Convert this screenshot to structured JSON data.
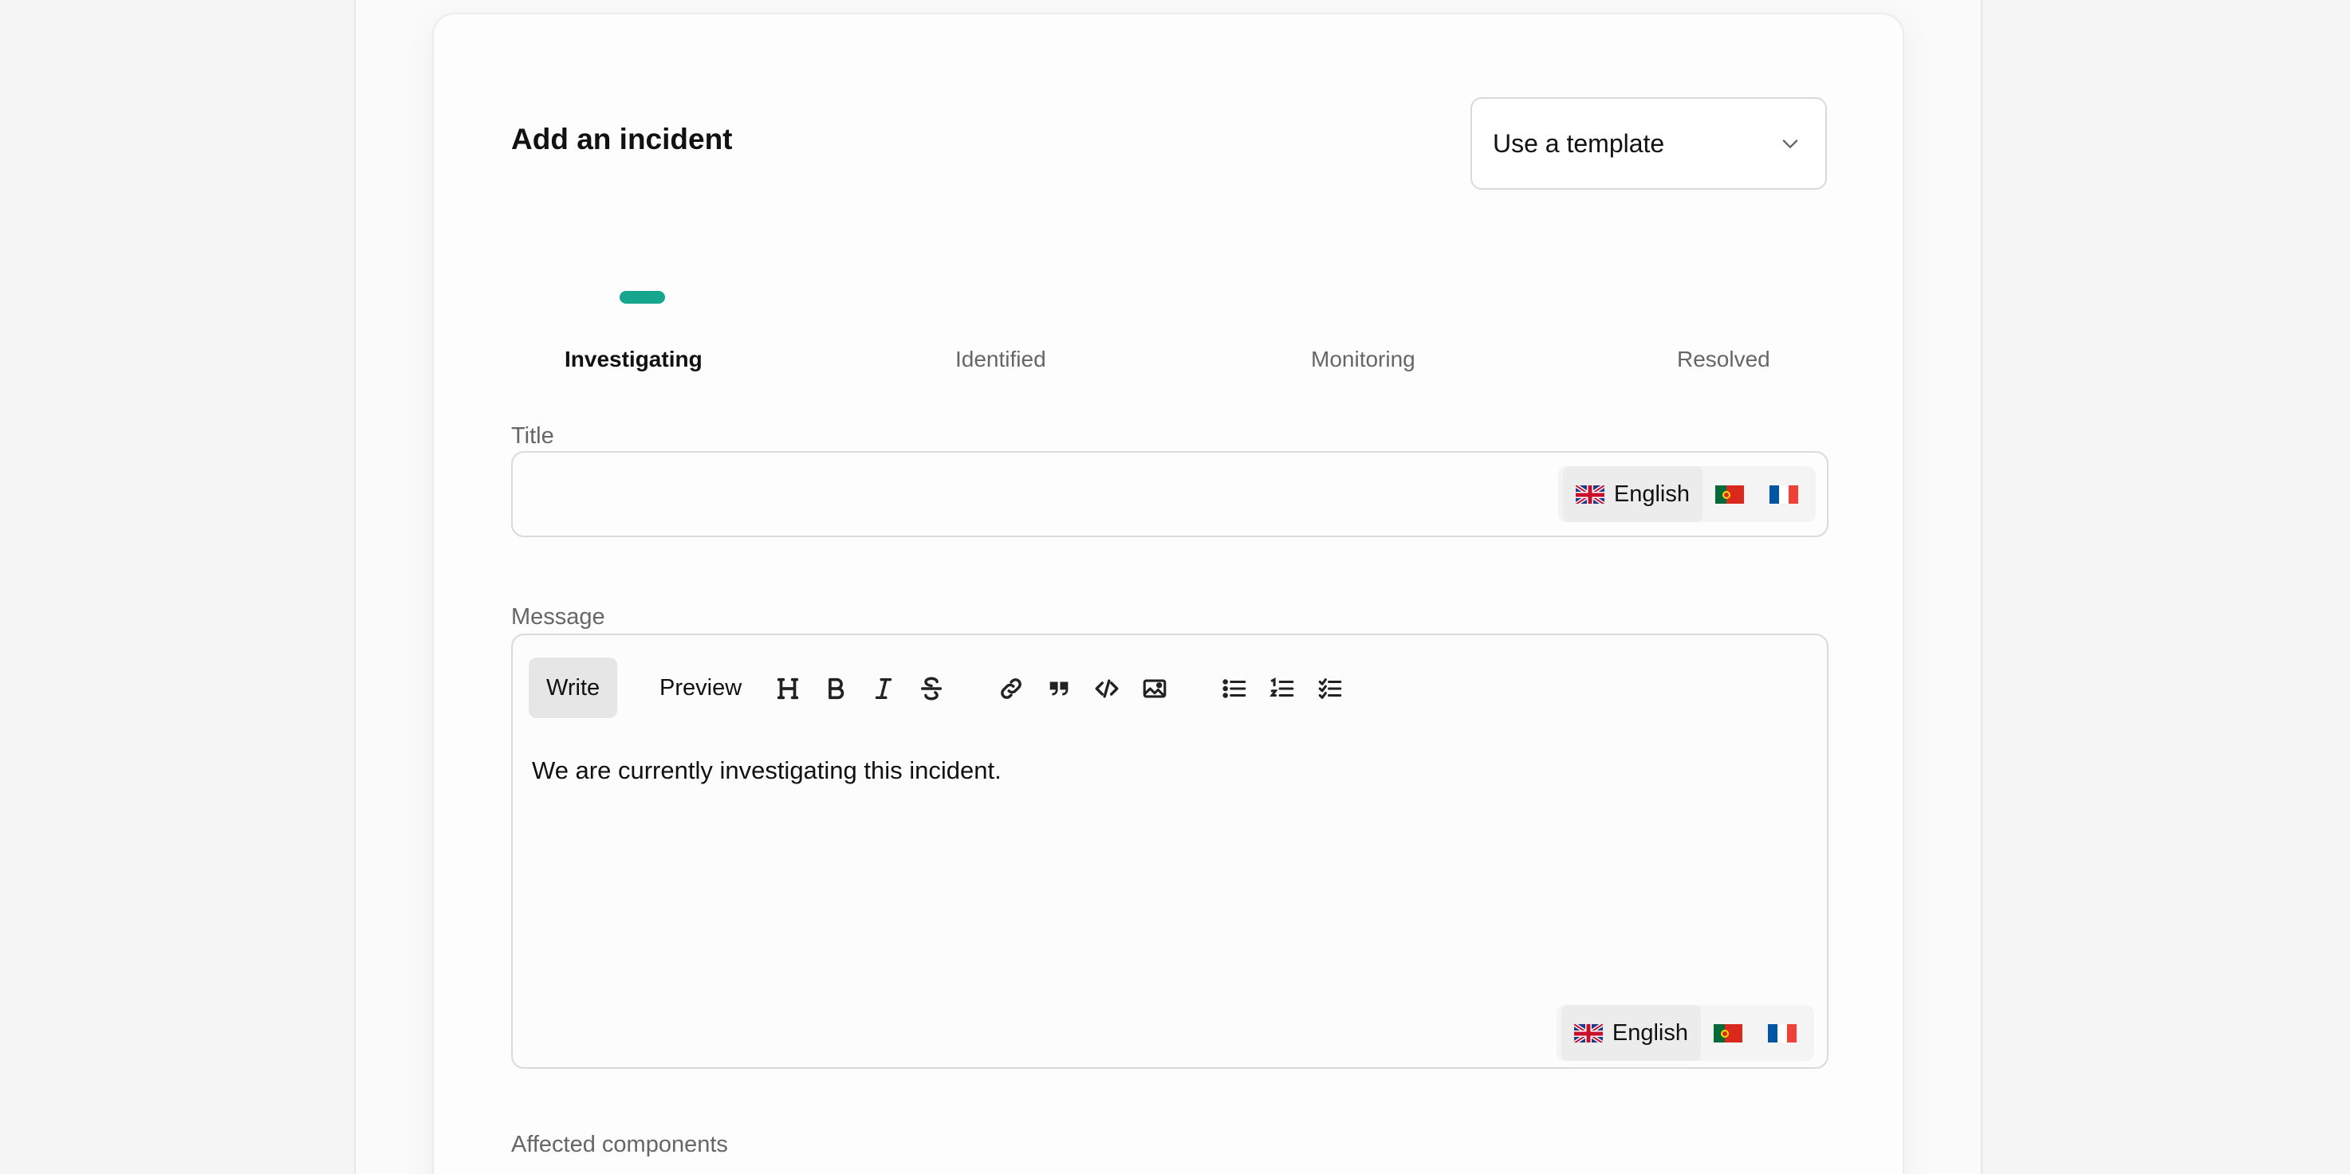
{
  "form": {
    "title": "Add an incident",
    "template_select": {
      "value": "Use a template"
    }
  },
  "steps": [
    {
      "label": "Investigating",
      "active": true
    },
    {
      "label": "Identified",
      "active": false
    },
    {
      "label": "Monitoring",
      "active": false
    },
    {
      "label": "Resolved",
      "active": false
    }
  ],
  "title_field": {
    "label": "Title",
    "value": "",
    "languages": {
      "active_label": "English",
      "options": [
        "English",
        "Portuguese",
        "French"
      ]
    }
  },
  "message_field": {
    "label": "Message",
    "tabs": {
      "write": "Write",
      "preview": "Preview",
      "active": "Write"
    },
    "toolbar": [
      "heading",
      "bold",
      "italic",
      "strikethrough",
      "link",
      "quote",
      "code",
      "image",
      "unordered-list",
      "ordered-list",
      "task-list"
    ],
    "value": "We are currently investigating this incident.",
    "languages": {
      "active_label": "English"
    }
  },
  "affected_components": {
    "label": "Affected components"
  },
  "colors": {
    "accent": "#16a58d",
    "border": "#dadada"
  }
}
